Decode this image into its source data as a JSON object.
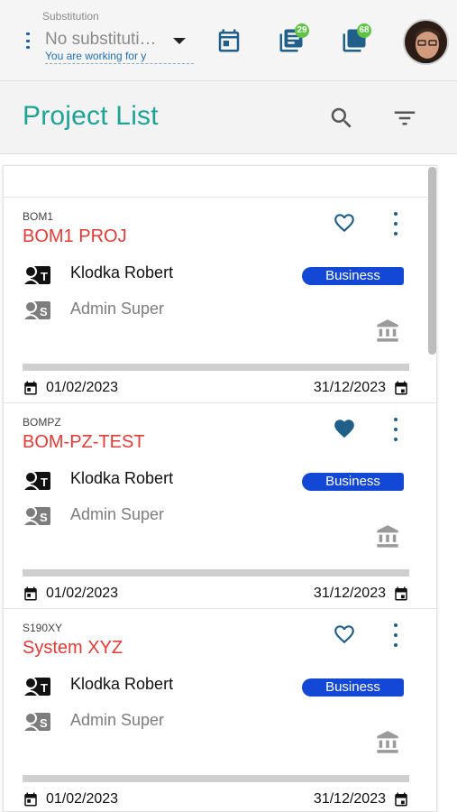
{
  "substitution": {
    "label": "Substitution",
    "value": "No substituti…",
    "hint": "You are working for y"
  },
  "topbar": {
    "calendar_icon": "calendar-icon",
    "list_badge": "29",
    "stack_badge": "68",
    "accent_color": "#1f5f8a",
    "badge_color": "#5fc444"
  },
  "header": {
    "title": "Project List",
    "title_color": "#1ea396"
  },
  "projects": [
    {
      "code": "BOM1",
      "name": "BOM1 PROJ",
      "favorite": false,
      "owner": "Klodka Robert",
      "admin": "Admin Super",
      "tag": "Business",
      "start": "01/02/2023",
      "end": "31/12/2023",
      "progress": 0
    },
    {
      "code": "BOMPZ",
      "name": "BOM-PZ-TEST",
      "favorite": true,
      "owner": "Klodka Robert",
      "admin": "Admin Super",
      "tag": "Business",
      "start": "01/02/2023",
      "end": "31/12/2023",
      "progress": 0
    },
    {
      "code": "S190XY",
      "name": "System XYZ",
      "favorite": false,
      "owner": "Klodka Robert",
      "admin": "Admin Super",
      "tag": "Business",
      "start": "01/02/2023",
      "end": "31/12/2023",
      "progress": 0
    }
  ],
  "colors": {
    "project_name": "#e53935",
    "tag_bg": "#1348d6"
  }
}
